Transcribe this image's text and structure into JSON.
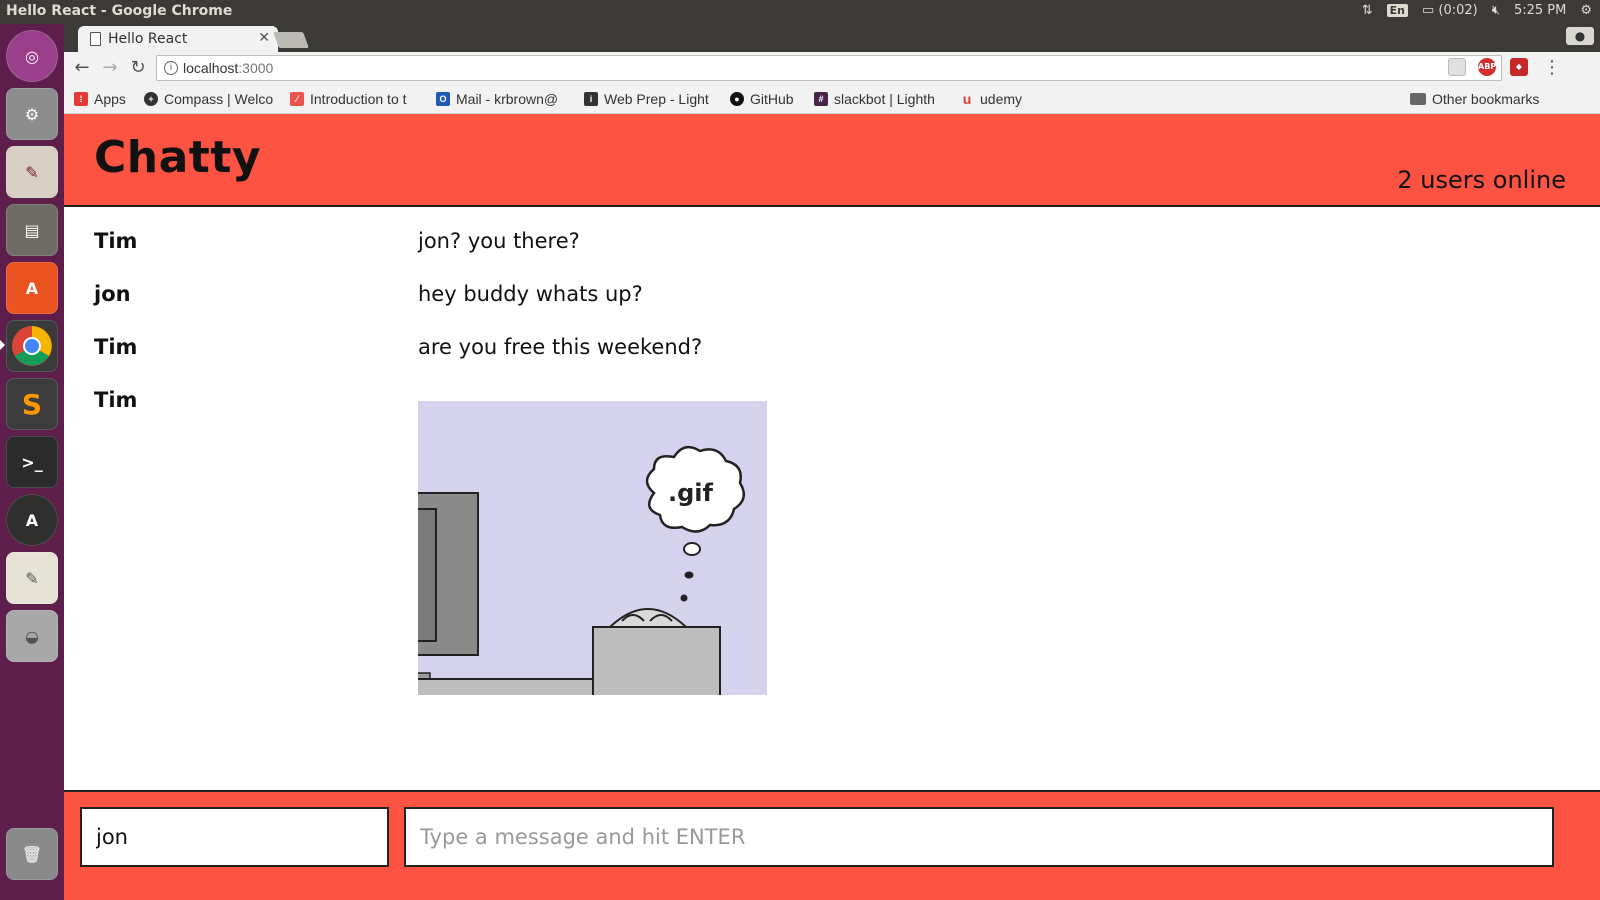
{
  "os": {
    "window_title": "Hello React - Google Chrome",
    "time": "5:25 PM",
    "battery": "(0:02)",
    "keyboard": "En"
  },
  "browser": {
    "tab_title": "Hello React",
    "url_host": "localhost",
    "url_port": ":3000",
    "bookmarks": [
      {
        "label": "Apps",
        "icon": "apps-grid-icon",
        "color": "#e53935"
      },
      {
        "label": "Compass | Welco",
        "icon": "compass-icon",
        "color": "#333333"
      },
      {
        "label": "Introduction to t",
        "icon": "lighthouse-icon",
        "color": "#ef5350"
      },
      {
        "label": "Mail - krbrown@",
        "icon": "outlook-icon",
        "color": "#1e5bb8"
      },
      {
        "label": "Web Prep - Light",
        "icon": "lighthouse-icon",
        "color": "#333333"
      },
      {
        "label": "GitHub",
        "icon": "github-icon",
        "color": "#111111"
      },
      {
        "label": "slackbot | Lighth",
        "icon": "slack-icon",
        "color": "#4a2448"
      },
      {
        "label": "udemy",
        "icon": "udemy-icon",
        "color": "#e3372a"
      }
    ],
    "other_bookmarks": "Other bookmarks"
  },
  "app": {
    "brand": "Chatty",
    "users_online": "2 users online",
    "accent_color": "#fc5343",
    "messages": [
      {
        "user": "Tim",
        "content": "jon? you there?"
      },
      {
        "user": "jon",
        "content": "hey buddy whats up?"
      },
      {
        "user": "Tim",
        "content": "are you free this weekend?"
      },
      {
        "user": "Tim",
        "content": "",
        "image": ".gif"
      }
    ],
    "username_value": "jon",
    "message_placeholder": "Type a message and hit ENTER"
  }
}
